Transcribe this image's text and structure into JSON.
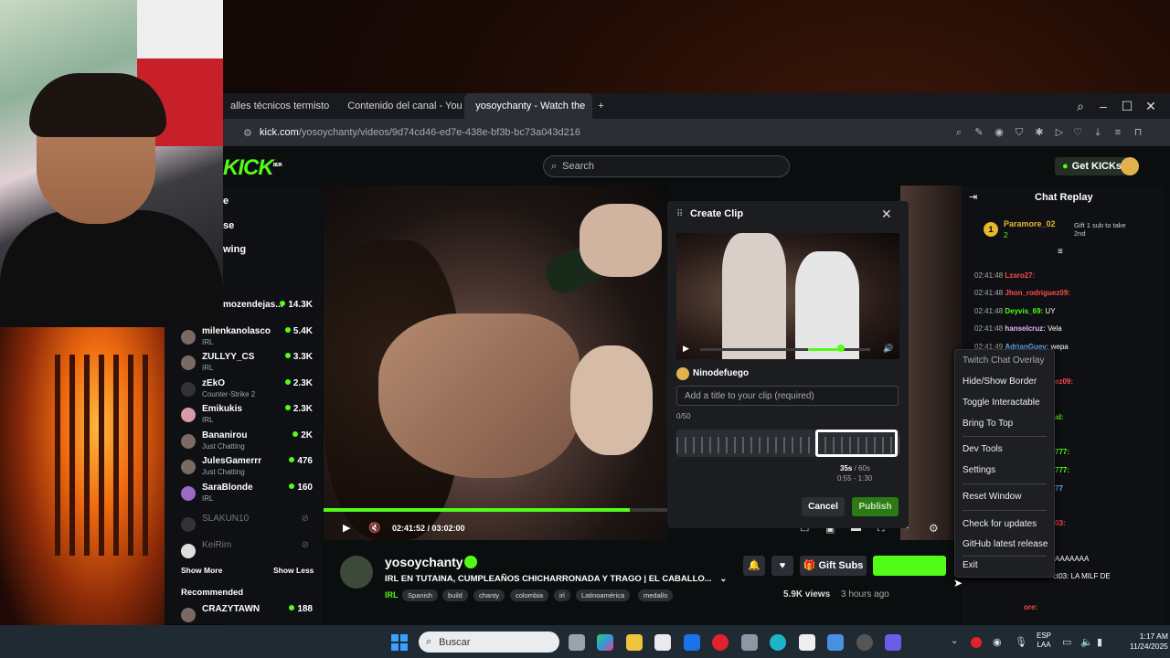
{
  "browser": {
    "tabs": [
      {
        "label": "alles técnicos termisto",
        "color": "#d24b3c"
      },
      {
        "label": "Contenido del canal - You",
        "color": "#ff0000"
      },
      {
        "label": "yosoychanty - Watch the",
        "color": "#53fc18"
      }
    ],
    "new_tab": "+",
    "url_domain": "kick.com",
    "url_path": "/yosoychanty/videos/9d74cd46-ed7e-438e-bf3b-bc73a043d216"
  },
  "header": {
    "logo": "KICK",
    "logo_badge": "BETA",
    "search_placeholder": "Search",
    "get_kicks": "Get KICKs"
  },
  "sidebar": {
    "nav_partial": [
      "e",
      "se",
      "wing"
    ],
    "channels": [
      {
        "name": "mozendejas...",
        "category": "",
        "viewers": "14.3K"
      },
      {
        "name": "milenkanolasco",
        "category": "IRL",
        "viewers": "5.4K"
      },
      {
        "name": "ZULLYY_CS",
        "category": "IRL",
        "viewers": "3.3K"
      },
      {
        "name": "zEkO",
        "category": "Counter-Strike 2",
        "viewers": "2.3K"
      },
      {
        "name": "Emikukis",
        "category": "IRL",
        "viewers": "2.3K"
      },
      {
        "name": "Bananirou",
        "category": "Just Chatting",
        "viewers": "2K"
      },
      {
        "name": "JulesGamerrr",
        "category": "Just Chatting",
        "viewers": "476"
      },
      {
        "name": "SaraBlonde",
        "category": "IRL",
        "viewers": "160"
      }
    ],
    "offline": [
      {
        "name": "SLAKUN10"
      },
      {
        "name": "KeiRim"
      }
    ],
    "show_more": "Show More",
    "show_less": "Show Less",
    "recommended": "Recommended",
    "recommended_channels": [
      {
        "name": "CRAZYTAWN",
        "viewers": "188"
      }
    ]
  },
  "player": {
    "timecode": "02:41:52 / 03:02:00",
    "progress": 0.89
  },
  "clip": {
    "title": "Create Clip",
    "close": "✕",
    "username": "Ninodefuego",
    "input_placeholder": "Add a title to your clip (required)",
    "char_count": "0/50",
    "duration": "35s",
    "duration_max": "/ 60s",
    "range": "0:55 - 1:30",
    "cancel": "Cancel",
    "publish": "Publish"
  },
  "stream": {
    "streamer": "yosoychanty",
    "title": "IRL EN TUTAINA, CUMPLEAÑOS CHICHARRONADA Y TRAGO | EL CABALLO...",
    "category": "IRL",
    "tags": [
      "Spanish",
      "build",
      "chanty",
      "colombia",
      "irl",
      "Latinoamérica",
      "medallo"
    ],
    "gift_subs": "Gift Subs",
    "views": "5.9K views",
    "ago": "3 hours ago"
  },
  "chat": {
    "title": "Chat Replay",
    "pinned_user": "Paramore_02",
    "pinned_rank": "1",
    "pinned_count": "2",
    "pinned_text": "Gift 1 sub to take 2nd",
    "messages": [
      {
        "time": "02:41:48",
        "user": "Lzaro27:",
        "text": "",
        "color": "#ff4b4b"
      },
      {
        "time": "02:41:48",
        "user": "Jhon_rodriguez09:",
        "text": "",
        "color": "#ff4b4b"
      },
      {
        "time": "02:41:48",
        "user": "Deyvis_69:",
        "text": "UY",
        "color": "#53fc18"
      },
      {
        "time": "02:41:48",
        "user": "hanselcruz:",
        "text": "Vela",
        "color": "#e8b9ff"
      },
      {
        "time": "02:41:49",
        "user": "AdrianGuev:",
        "text": "wepa",
        "color": "#6fb3ff"
      }
    ],
    "partial_lines": [
      "ez09:",
      "al:",
      "777:",
      "777:",
      "77",
      "03:",
      "AAAAAAA",
      "ct03: LA MILF DE",
      "ore:"
    ]
  },
  "context_menu": {
    "header": "Twitch Chat Overlay",
    "items": [
      "Hide/Show Border",
      "Toggle Interactable",
      "Bring To Top",
      "Dev Tools",
      "Settings",
      "Reset Window",
      "Check for updates",
      "GitHub latest release",
      "Exit"
    ]
  },
  "taskbar": {
    "search": "Buscar",
    "lang_1": "ESP",
    "lang_2": "LAA",
    "time": "1:17 AM",
    "date": "11/24/2025"
  }
}
